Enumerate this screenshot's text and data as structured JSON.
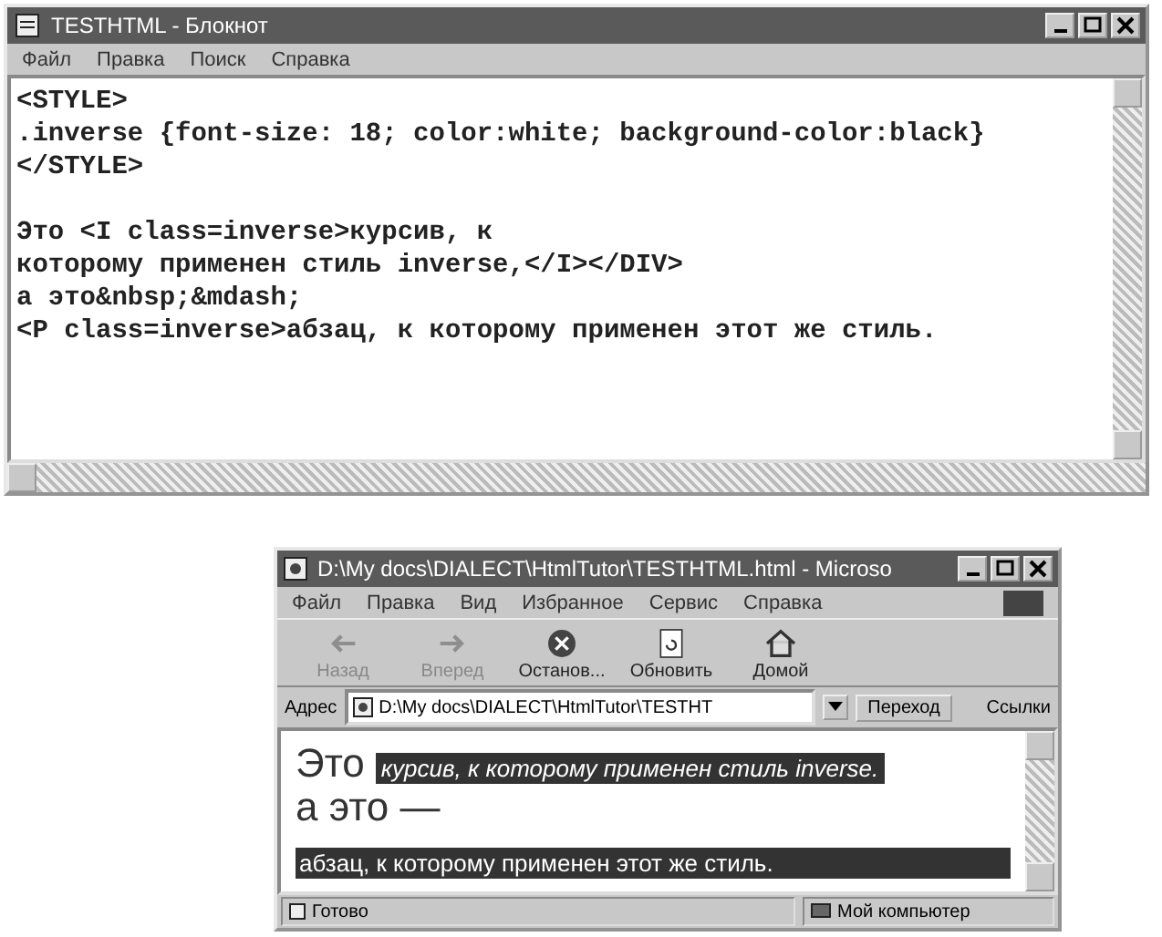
{
  "notepad": {
    "title": "TESTHTML - Блокнот",
    "menu": [
      "Файл",
      "Правка",
      "Поиск",
      "Справка"
    ],
    "style_lines": [
      "<STYLE>",
      ".inverse {font-size: 18; color:white; background-color:black}",
      "</STYLE>"
    ],
    "body_lines": [
      "Это <I class=inverse>курсив, к",
      "которому применен стиль inverse,</I></DIV>",
      "а это&nbsp;&mdash;",
      "<P class=inverse>абзац, к которому применен этот же стиль."
    ]
  },
  "browser": {
    "title": "D:\\My docs\\DIALECT\\HtmlTutor\\TESTHTML.html - Microso",
    "menu": [
      "Файл",
      "Правка",
      "Вид",
      "Избранное",
      "Сервис",
      "Справка"
    ],
    "toolbar": [
      {
        "kind": "back",
        "label": "Назад",
        "disabled": true
      },
      {
        "kind": "forward",
        "label": "Вперед",
        "disabled": true
      },
      {
        "kind": "stop",
        "label": "Останов...",
        "disabled": false
      },
      {
        "kind": "refresh",
        "label": "Обновить",
        "disabled": false
      },
      {
        "kind": "home",
        "label": "Домой",
        "disabled": false
      }
    ],
    "address": {
      "label": "Адрес",
      "value": "D:\\My docs\\DIALECT\\HtmlTutor\\TESTHT",
      "go": "Переход",
      "links": "Ссылки"
    },
    "content": {
      "lead": "Это",
      "inverse_italic": "курсив, к которому применен стиль inverse.",
      "line2": "а это —",
      "inverse_paragraph": "абзац, к которому применен этот же стиль."
    },
    "status": {
      "text": "Готово",
      "zone": "Мой компьютер"
    }
  }
}
